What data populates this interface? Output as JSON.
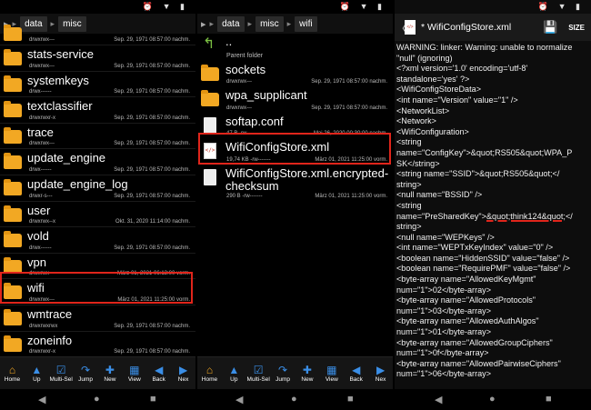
{
  "status": {
    "icons": "⏰ ▼ ▮"
  },
  "left": {
    "crumbs": [
      "data",
      "misc"
    ],
    "top_partial": {
      "perm": "drwxrwx---",
      "date": "Sep. 29, 1971 08:57:00 nachm."
    },
    "items": [
      {
        "name": "stats-service",
        "perm": "drwxrwx---",
        "date": "Sep. 29, 1971 08:57:00 nachm."
      },
      {
        "name": "systemkeys",
        "perm": "drwx------",
        "date": "Sep. 29, 1971 08:57:00 nachm."
      },
      {
        "name": "textclassifier",
        "perm": "drwxrwxr-x",
        "date": "Sep. 29, 1971 08:57:00 nachm."
      },
      {
        "name": "trace",
        "perm": "drwxrwx---",
        "date": "Sep. 29, 1971 08:57:00 nachm."
      },
      {
        "name": "update_engine",
        "perm": "drwx------",
        "date": "Sep. 29, 1971 08:57:00 nachm."
      },
      {
        "name": "update_engine_log",
        "perm": "drwxr-s---",
        "date": "Sep. 29, 1971 08:57:00 nachm."
      },
      {
        "name": "user",
        "perm": "drwxrwx--x",
        "date": "Okt. 31, 2020 11:14:00 nachm."
      },
      {
        "name": "vold",
        "perm": "drwx------",
        "date": "Sep. 29, 1971 08:57:00 nachm."
      },
      {
        "name": "vpn",
        "perm": "drwxrwx---",
        "date": "März 01, 2021 06:13:00 vorm."
      },
      {
        "name": "wifi",
        "perm": "drwxrwx---",
        "date": "März 01, 2021 11:25:00 vorm."
      },
      {
        "name": "wmtrace",
        "perm": "drwxrwxrwx",
        "date": "Sep. 29, 1971 08:57:00 nachm."
      },
      {
        "name": "zoneinfo",
        "perm": "drwxrwxr-x",
        "date": "Sep. 29, 1971 08:57:00 nachm."
      }
    ]
  },
  "middle": {
    "crumbs": [
      "data",
      "misc",
      "wifi"
    ],
    "parent": {
      "name": "..",
      "sub": "Parent folder"
    },
    "items": [
      {
        "name": "sockets",
        "perm": "drwxrwx---",
        "date": "Sep. 29, 1971 08:57:00 nachm."
      },
      {
        "name": "wpa_supplicant",
        "perm": "drwxrwx---",
        "date": "Sep. 29, 1971 08:57:00 nachm."
      },
      {
        "name": "softap.conf",
        "perm": "47 B -rw-------",
        "date": "Mai 26, 2020 00:30:00 nachm."
      },
      {
        "name": "WifiConfigStore.xml",
        "perm": "19,74 KB -rw-------",
        "date": "März 01, 2021 11:25:00 vorm."
      },
      {
        "name": "WifiConfigStore.xml.encrypted-",
        "name2": "checksum",
        "perm": "290 B -rw-------",
        "date": "März 01, 2021 11:25:00 vorm."
      }
    ]
  },
  "toolbar": [
    {
      "label": "Home",
      "glyph": "⌂"
    },
    {
      "label": "Up",
      "glyph": "▲"
    },
    {
      "label": "Multi-Sel",
      "glyph": "☑"
    },
    {
      "label": "Jump",
      "glyph": "↷"
    },
    {
      "label": "New",
      "glyph": "✚"
    },
    {
      "label": "View",
      "glyph": "▦"
    },
    {
      "label": "Back",
      "glyph": "◀"
    },
    {
      "label": "Nex",
      "glyph": "▶"
    }
  ],
  "editor": {
    "back": "〈",
    "file_icon": "</>",
    "title": "* WifiConfigStore.xml",
    "save_glyph": "💾",
    "size_label": "SIZE",
    "lines": [
      "WARNING: linker: Warning: unable to normalize",
      "\"null\" (ignoring)",
      "<?xml version='1.0' encoding='utf-8'",
      "standalone='yes' ?>",
      "<WifiConfigStoreData>",
      "<int name=\"Version\" value=\"1\" />",
      "<NetworkList>",
      "<Network>",
      "<WifiConfiguration>",
      "<string",
      "name=\"ConfigKey\">&quot;RS505&quot;WPA_P",
      "SK</string>",
      "<string name=\"SSID\">&quot;RS505&quot;</",
      "string>",
      "<null name=\"BSSID\" />",
      "<string",
      "name=\"PreSharedKey\">&quot;think124&quot;</",
      "string>",
      "<null name=\"WEPKeys\" />",
      "<int name=\"WEPTxKeyIndex\" value=\"0\" />",
      "<boolean name=\"HiddenSSID\" value=\"false\" />",
      "<boolean name=\"RequirePMF\" value=\"false\" />",
      "<byte-array name=\"AllowedKeyMgmt\"",
      "num=\"1\">02</byte-array>",
      "<byte-array name=\"AllowedProtocols\"",
      "num=\"1\">03</byte-array>",
      "<byte-array name=\"AllowedAuthAlgos\"",
      "num=\"1\">01</byte-array>",
      "<byte-array name=\"AllowedGroupCiphers\"",
      "num=\"1\">0f</byte-array>",
      "<byte-array name=\"AllowedPairwiseCiphers\"",
      "num=\"1\">06</byte-array>"
    ],
    "psk_prefix": "name=\"PreSharedKey\">",
    "psk_highlight": "&quot;think124&quot;",
    "psk_suffix": "</"
  },
  "nav": {
    "back": "◀",
    "home": "●",
    "recents": "■"
  },
  "colors": {
    "folder": "#f2a823",
    "highlight": "#e0251b",
    "toolbar_icon": "#3a8ee6"
  }
}
